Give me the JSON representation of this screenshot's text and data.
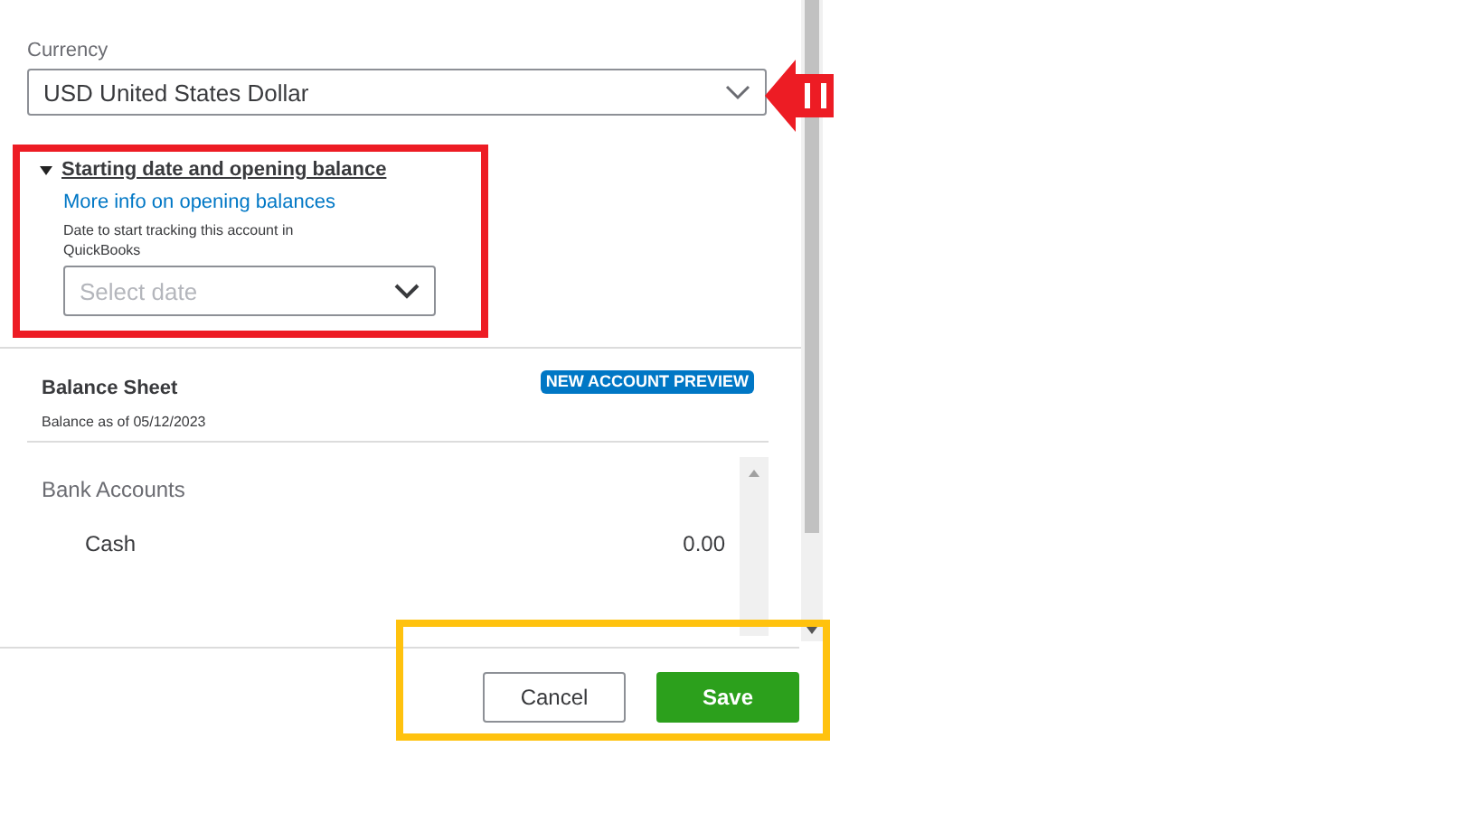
{
  "currency": {
    "label": "Currency",
    "value": "USD United States Dollar"
  },
  "opening_balance": {
    "title": "Starting date and opening balance",
    "expanded": true,
    "link": "More info on opening balances",
    "hint": "Date to start tracking this account in QuickBooks",
    "date_field": {
      "placeholder": "Select date"
    }
  },
  "preview": {
    "title": "Balance Sheet",
    "subtitle": "Balance as of 05/12/2023",
    "badge": "NEW ACCOUNT PREVIEW",
    "group": "Bank Accounts",
    "rows": [
      {
        "name": "Cash",
        "amount": "0.00"
      }
    ]
  },
  "buttons": [
    {
      "label": "Cancel",
      "kind": "secondary"
    },
    {
      "label": "Save",
      "kind": "primary"
    }
  ]
}
